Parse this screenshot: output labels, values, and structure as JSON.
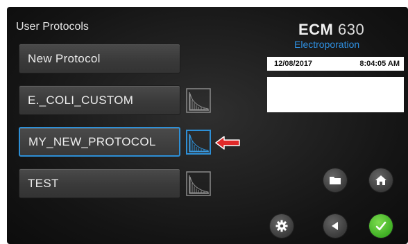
{
  "title": "User Protocols",
  "protocols": [
    {
      "label": "New Protocol",
      "has_waveform": false,
      "selected": false
    },
    {
      "label": "E._COLI_CUSTOM",
      "has_waveform": true,
      "selected": false
    },
    {
      "label": "MY_NEW_PROTOCOL",
      "has_waveform": true,
      "selected": true
    },
    {
      "label": "TEST",
      "has_waveform": true,
      "selected": false
    }
  ],
  "logo": {
    "brand": "ECM",
    "model": "630",
    "subtitle": "Electroporation"
  },
  "status": {
    "date": "12/08/2017",
    "time": "8:04:05 AM"
  },
  "controls": [
    "folder-icon",
    "home-icon",
    "gear-icon",
    "back-icon",
    "check-icon"
  ],
  "colors": {
    "accent_blue": "#2d8fd6",
    "confirm_green": "#3fae24",
    "arrow_red": "#e02a2a"
  }
}
